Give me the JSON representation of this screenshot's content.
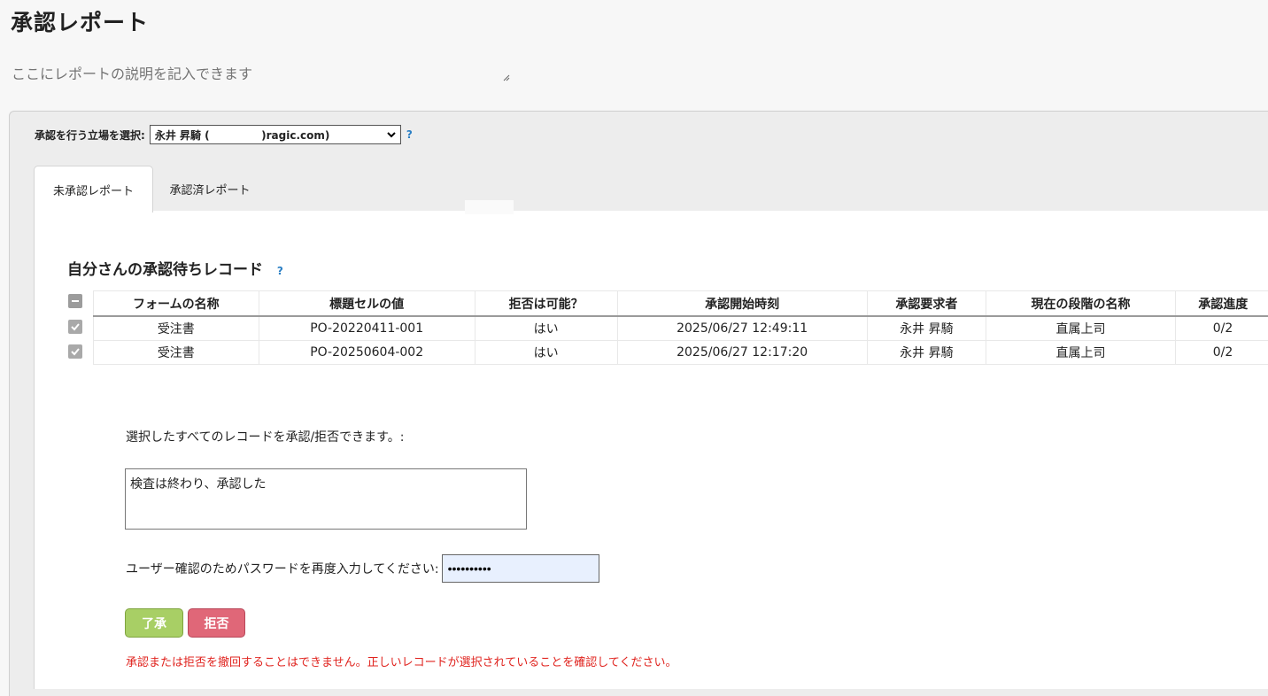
{
  "page": {
    "title": "承認レポート",
    "description_placeholder": "ここにレポートの説明を記入できます"
  },
  "role": {
    "label": "承認を行う立場を選択:",
    "selected": "永井 昇騎 (              )ragic.com)",
    "help": "?"
  },
  "tabs": [
    {
      "label": "未承認レポート",
      "active": true
    },
    {
      "label": "承認済レポート",
      "active": false
    }
  ],
  "section": {
    "title": "自分さんの承認待ちレコード",
    "help": "?"
  },
  "table": {
    "headers": [
      "フォームの名称",
      "標題セルの値",
      "拒否は可能？",
      "承認開始時刻",
      "承認要求者",
      "現在の段階の名称",
      "承認進度"
    ],
    "rows": [
      [
        "受注書",
        "PO-20220411-001",
        "はい",
        "2025/06/27 12:49:11",
        "永井 昇騎",
        "直属上司",
        "0/2"
      ],
      [
        "受注書",
        "PO-20250604-002",
        "はい",
        "2025/06/27 12:17:20",
        "永井 昇騎",
        "直属上司",
        "0/2"
      ]
    ]
  },
  "bulk": {
    "label": "選択したすべてのレコードを承認/拒否できます。:",
    "comment": "検査は終わり、承認した"
  },
  "password": {
    "label": "ユーザー確認のためパスワードを再度入力してください:",
    "value": "••••••••••"
  },
  "actions": {
    "approve": "了承",
    "reject": "拒否"
  },
  "warning": "承認または拒否を撤回することはできません。正しいレコードが選択されていることを確認してください。",
  "colors": {
    "approve": "#a8cf65",
    "reject": "#e06778",
    "warning": "#e0241f",
    "help": "#2a7fc4"
  }
}
